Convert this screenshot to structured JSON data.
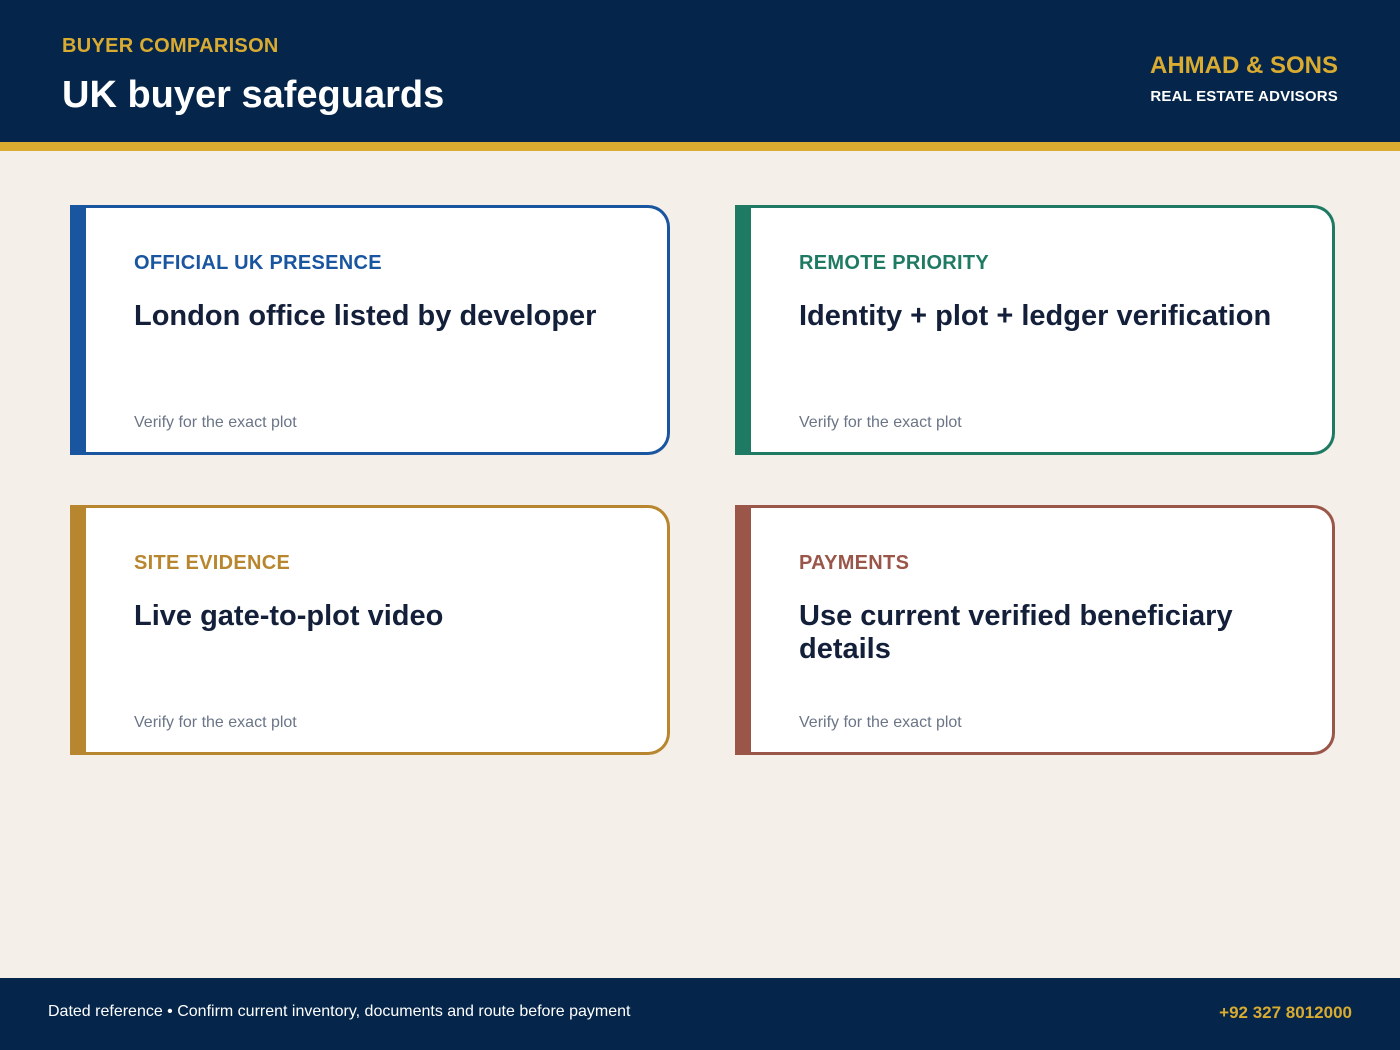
{
  "colors": {
    "navy": "#05264a",
    "gold": "#d9ab30",
    "cream": "#f4efe8",
    "blue": "#1a56a0",
    "green": "#1f7a63",
    "amber": "#b8862e",
    "brick": "#9b564a"
  },
  "header": {
    "eyebrow": "BUYER COMPARISON",
    "title": "UK buyer safeguards",
    "brand_name": "AHMAD & SONS",
    "brand_tag": "REAL ESTATE ADVISORS"
  },
  "cards": [
    {
      "label": "OFFICIAL UK PRESENCE",
      "title": "London office listed by developer",
      "note": "Verify for the exact plot",
      "color": "#1a56a0"
    },
    {
      "label": "REMOTE PRIORITY",
      "title": "Identity + plot + ledger verification",
      "note": "Verify for the exact plot",
      "color": "#1f7a63"
    },
    {
      "label": "SITE EVIDENCE",
      "title": "Live gate-to-plot video",
      "note": "Verify for the exact plot",
      "color": "#b8862e"
    },
    {
      "label": "PAYMENTS",
      "title": "Use current verified beneficiary details",
      "note": "Verify for the exact plot",
      "color": "#9b564a"
    }
  ],
  "footer": {
    "note": "Dated reference • Confirm current inventory, documents and route before payment",
    "phone": "+92 327 8012000"
  }
}
